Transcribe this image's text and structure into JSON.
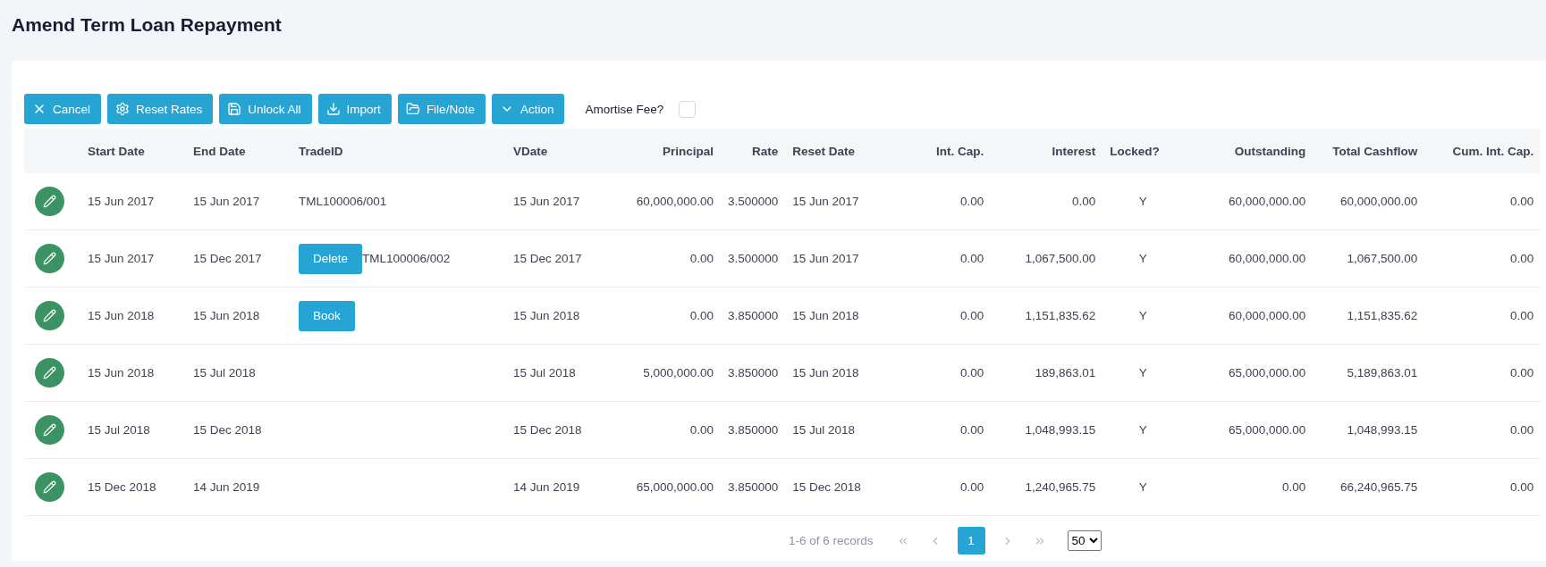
{
  "page": {
    "title": "Amend Term Loan Repayment"
  },
  "toolbar": {
    "buttons": [
      "Cancel",
      "Reset Rates",
      "Unlock All",
      "Import",
      "File/Note",
      "Action"
    ],
    "amortise_fee": {
      "label": "Amortise Fee?",
      "checked": false
    }
  },
  "table": {
    "columns": [
      "Start Date",
      "End Date",
      "TradeID",
      "VDate",
      "Principal",
      "Rate",
      "Reset Date",
      "Int. Cap.",
      "Interest",
      "Locked?",
      "Outstanding",
      "Total Cashflow",
      "Cum. Int. Cap."
    ],
    "rows": [
      {
        "start_date": "15 Jun 2017",
        "end_date": "15 Jun 2017",
        "trade_id": "TML100006/001",
        "vdate": "15 Jun 2017",
        "principal": "60,000,000.00",
        "rate": "3.500000",
        "reset_date": "15 Jun 2017",
        "int_cap": "0.00",
        "interest": "0.00",
        "locked": "Y",
        "outstanding": "60,000,000.00",
        "total_cashflow": "60,000,000.00",
        "cum_int_cap": "0.00"
      },
      {
        "start_date": "15 Jun 2017",
        "end_date": "15 Dec 2017",
        "trade_action": "Delete",
        "trade_id": "TML100006/002",
        "vdate": "15 Dec 2017",
        "principal": "0.00",
        "rate": "3.500000",
        "reset_date": "15 Jun 2017",
        "int_cap": "0.00",
        "interest": "1,067,500.00",
        "locked": "Y",
        "outstanding": "60,000,000.00",
        "total_cashflow": "1,067,500.00",
        "cum_int_cap": "0.00"
      },
      {
        "start_date": "15 Jun 2018",
        "end_date": "15 Jun 2018",
        "trade_action": "Book",
        "vdate": "15 Jun 2018",
        "principal": "0.00",
        "rate": "3.850000",
        "reset_date": "15 Jun 2018",
        "int_cap": "0.00",
        "interest": "1,151,835.62",
        "locked": "Y",
        "outstanding": "60,000,000.00",
        "total_cashflow": "1,151,835.62",
        "cum_int_cap": "0.00"
      },
      {
        "start_date": "15 Jun 2018",
        "end_date": "15 Jul 2018",
        "vdate": "15 Jul 2018",
        "principal": "5,000,000.00",
        "rate": "3.850000",
        "reset_date": "15 Jun 2018",
        "int_cap": "0.00",
        "interest": "189,863.01",
        "locked": "Y",
        "outstanding": "65,000,000.00",
        "total_cashflow": "5,189,863.01",
        "cum_int_cap": "0.00"
      },
      {
        "start_date": "15 Jul 2018",
        "end_date": "15 Dec 2018",
        "vdate": "15 Dec 2018",
        "principal": "0.00",
        "rate": "3.850000",
        "reset_date": "15 Jul 2018",
        "int_cap": "0.00",
        "interest": "1,048,993.15",
        "locked": "Y",
        "outstanding": "65,000,000.00",
        "total_cashflow": "1,048,993.15",
        "cum_int_cap": "0.00"
      },
      {
        "start_date": "15 Dec 2018",
        "end_date": "14 Jun 2019",
        "vdate": "14 Jun 2019",
        "principal": "65,000,000.00",
        "rate": "3.850000",
        "reset_date": "15 Dec 2018",
        "int_cap": "0.00",
        "interest": "1,240,965.75",
        "locked": "Y",
        "outstanding": "0.00",
        "total_cashflow": "66,240,965.75",
        "cum_int_cap": "0.00"
      }
    ]
  },
  "pagination": {
    "summary": "1-6 of 6 records",
    "pages": [
      {
        "label": "1",
        "selected": true
      }
    ],
    "page_size": "50"
  }
}
